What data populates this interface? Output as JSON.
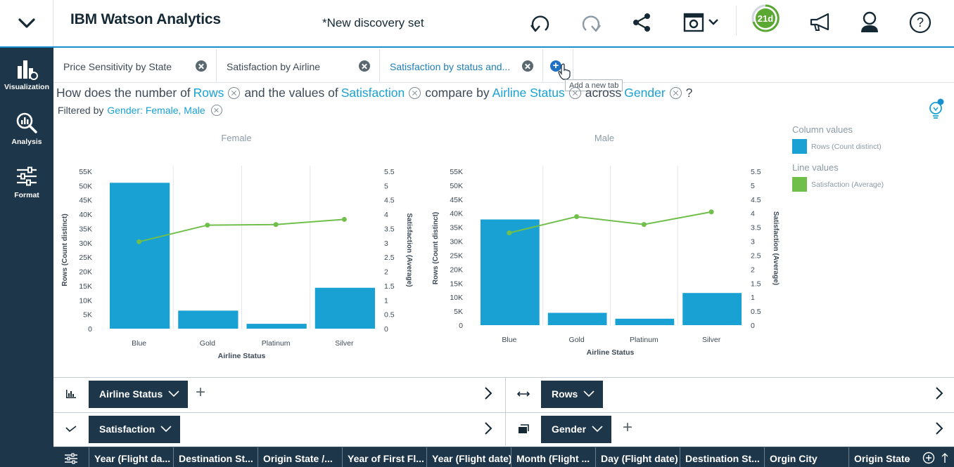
{
  "header": {
    "app_title": "IBM Watson Analytics",
    "doc_title": "*New discovery set",
    "trial_days": "21d"
  },
  "leftrail": {
    "items": [
      {
        "label": "Visualization",
        "icon": "visualization-icon"
      },
      {
        "label": "Analysis",
        "icon": "analysis-icon"
      },
      {
        "label": "Format",
        "icon": "format-icon"
      }
    ]
  },
  "tabs": [
    {
      "label": "Price Sensitivity by State"
    },
    {
      "label": "Satisfaction by Airline"
    },
    {
      "label": "Satisfaction by status and..."
    }
  ],
  "add_tab_tooltip": "Add a new tab",
  "question": {
    "p1": "How does the number of",
    "k1": "Rows",
    "p2": "and the values of",
    "k2": "Satisfaction",
    "p3": "compare by",
    "k3": "Airline Status",
    "p4": "across",
    "k4": "Gender",
    "p5": "?"
  },
  "filter": {
    "label": "Filtered by",
    "value": "Gender: Female, Male"
  },
  "colors": {
    "bar": "#1aa1d4",
    "line": "#6fbf4a",
    "dark": "#1d3649",
    "accent": "#1a8fd0",
    "trial": "#5aa832"
  },
  "chart_data": [
    {
      "type": "bar+line",
      "title": "Female",
      "categories": [
        "Blue",
        "Gold",
        "Platinum",
        "Silver"
      ],
      "xlabel": "Airline Status",
      "ylabel": "Rows (Count distinct)",
      "y2label": "Satisfaction (Average)",
      "ylim": [
        0,
        55000
      ],
      "y2lim": [
        0,
        5.5
      ],
      "yticks": [
        "0",
        "5K",
        "10K",
        "15K",
        "20K",
        "25K",
        "30K",
        "35K",
        "40K",
        "45K",
        "50K",
        "55K"
      ],
      "y2ticks": [
        "0",
        "0.5",
        "1",
        "1.5",
        "2",
        "2.5",
        "3",
        "3.5",
        "4",
        "4.5",
        "5",
        "5.5"
      ],
      "series": [
        {
          "name": "Rows (Count distinct)",
          "kind": "bar",
          "values": [
            51000,
            6300,
            1700,
            14300
          ]
        },
        {
          "name": "Satisfaction (Average)",
          "kind": "line",
          "values": [
            3.04,
            3.62,
            3.64,
            3.82
          ]
        }
      ]
    },
    {
      "type": "bar+line",
      "title": "Male",
      "categories": [
        "Blue",
        "Gold",
        "Platinum",
        "Silver"
      ],
      "xlabel": "Airline Status",
      "ylabel": "Rows (Count distinct)",
      "y2label": "Satisfaction (Average)",
      "ylim": [
        0,
        55000
      ],
      "y2lim": [
        0,
        5.5
      ],
      "yticks": [
        "0",
        "5K",
        "10K",
        "15K",
        "20K",
        "25K",
        "30K",
        "35K",
        "40K",
        "45K",
        "50K",
        "55K"
      ],
      "y2ticks": [
        "0",
        "0.5",
        "1",
        "1.5",
        "2",
        "2.5",
        "3",
        "3.5",
        "4",
        "4.5",
        "5",
        "5.5"
      ],
      "series": [
        {
          "name": "Rows (Count distinct)",
          "kind": "bar",
          "values": [
            37800,
            4400,
            2300,
            11500
          ]
        },
        {
          "name": "Satisfaction (Average)",
          "kind": "line",
          "values": [
            3.3,
            3.88,
            3.6,
            4.05
          ]
        }
      ]
    }
  ],
  "legend": {
    "column_heading": "Column values",
    "column_item": "Rows (Count distinct)",
    "line_heading": "Line values",
    "line_item": "Satisfaction (Average)"
  },
  "shelves": {
    "x_axis": "Airline Status",
    "columns": "Rows",
    "lines": "Satisfaction",
    "repeat": "Gender"
  },
  "columns_bar": [
    "Year (Flight da...",
    "Destination St...",
    "Origin State /...",
    "Year of First Fl...",
    "Year (Flight date)",
    "Month (Flight ...",
    "Day (Flight date)",
    "Destination St...",
    "Orgin City",
    "Origin State"
  ]
}
